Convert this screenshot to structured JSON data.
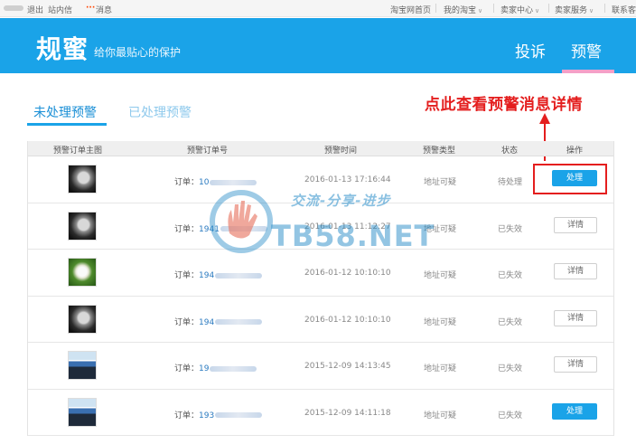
{
  "topbar": {
    "left": {
      "logout": "退出",
      "messages_center": "站内信",
      "dots": "···",
      "notify": "消息"
    },
    "right": [
      "淘宝网首页",
      "我的淘宝",
      "卖家中心",
      "卖家服务",
      "联系客"
    ]
  },
  "header": {
    "title": "规蜜",
    "subtitle": "给你最贴心的保护",
    "nav": [
      {
        "label": "投诉",
        "active": false
      },
      {
        "label": "预警",
        "active": true
      }
    ]
  },
  "tabs": [
    {
      "label": "未处理预警",
      "active": true
    },
    {
      "label": "已处理预警",
      "active": false
    }
  ],
  "annotation": "点此查看预警消息详情",
  "table": {
    "headers": [
      "预警订单主图",
      "预警订单号",
      "预警时间",
      "预警类型",
      "状态",
      "操作"
    ],
    "rows": [
      {
        "thumb": "dark",
        "order_label": "订单：",
        "order_prefix": "10",
        "time": "2016-01-13 17:16:44",
        "type": "地址可疑",
        "status": "待处理",
        "action": "处理"
      },
      {
        "thumb": "dark",
        "order_label": "订单：",
        "order_prefix": "1941",
        "time": "2016-01-13 11:12:27",
        "type": "地址可疑",
        "status": "已失效",
        "action": "详情"
      },
      {
        "thumb": "flower",
        "order_label": "订单：",
        "order_prefix": "194",
        "time": "2016-01-12 10:10:10",
        "type": "地址可疑",
        "status": "已失效",
        "action": "详情"
      },
      {
        "thumb": "dark",
        "order_label": "订单：",
        "order_prefix": "194",
        "time": "2016-01-12 10:10:10",
        "type": "地址可疑",
        "status": "已失效",
        "action": "详情"
      },
      {
        "thumb": "penguin",
        "order_label": "订单：",
        "order_prefix": "19",
        "time": "2015-12-09 14:13:45",
        "type": "地址可疑",
        "status": "已失效",
        "action": "详情"
      },
      {
        "thumb": "penguin",
        "order_label": "订单：",
        "order_prefix": "193",
        "time": "2015-12-09 14:11:18",
        "type": "地址可疑",
        "status": "已失效",
        "action": "处理"
      }
    ]
  },
  "watermark": {
    "slogan": "交流-分享-进步",
    "brand": "TB58.NET"
  },
  "colors": {
    "header_blue": "#1aa3e8",
    "annotation_red": "#e41e1e",
    "nav_active_underline": "#f4a0c8"
  }
}
